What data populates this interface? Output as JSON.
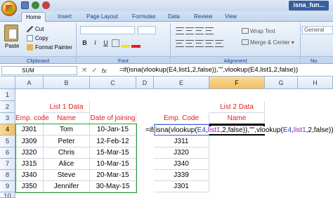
{
  "window": {
    "title": "isna_fun..."
  },
  "tabs": [
    "Home",
    "Insert",
    "Page Layout",
    "Formulas",
    "Data",
    "Review",
    "View"
  ],
  "ribbon": {
    "clipboard": {
      "paste": "Paste",
      "cut": "Cut",
      "copy": "Copy",
      "format_painter": "Format Painter",
      "label": "Clipboard"
    },
    "font": {
      "label": "Font",
      "bold": "B",
      "italic": "I",
      "underline": "U"
    },
    "alignment": {
      "wrap_text": "Wrap Text",
      "merge_center": "Merge & Center",
      "label": "Alignment"
    },
    "number": {
      "format": "General",
      "label": "Nu"
    }
  },
  "formula_bar": {
    "name_box": "SUM",
    "fx": "fx",
    "formula": "=if(isna(vlookup(E4,list1,2,false)),\"\",vlookup(E4,list1,2,false))"
  },
  "columns": [
    "A",
    "B",
    "C",
    "D",
    "E",
    "F",
    "G",
    "H"
  ],
  "rows": [
    "1",
    "2",
    "3",
    "4",
    "5",
    "6",
    "7",
    "8",
    "9",
    "10"
  ],
  "cells": {
    "B2": "List 1 Data",
    "A3": "Emp. code",
    "B3": "Name",
    "C3": "Date of joining",
    "E3": "Emp. Code",
    "F2": "List 2 Data",
    "F3": "Name",
    "A4": "J301",
    "B4": "Tom",
    "C4": "10-Jan-15",
    "A5": "J309",
    "B5": "Peter",
    "C5": "12-Feb-12",
    "A6": "J320",
    "B6": "Chris",
    "C6": "15-Mar-15",
    "A7": "J315",
    "B7": "Alice",
    "C7": "10-Mar-15",
    "A8": "J340",
    "B8": "Steve",
    "C8": "20-Mar-15",
    "A9": "J350",
    "B9": "Jennifer",
    "C9": "30-May-15",
    "E5": "J311",
    "E6": "J320",
    "E7": "J340",
    "E8": "J339",
    "E9": "J301"
  },
  "active_cell": {
    "ref": "F4",
    "p1": "=if(isna(vlookup(",
    "ref1": "E4",
    "p2": ",",
    "ref2": "list1",
    "p3": ",2,false)),\"\",vlookup(",
    "ref3": "E4",
    "p4": ",",
    "ref4": "list1",
    "p5": ",2,false))"
  }
}
